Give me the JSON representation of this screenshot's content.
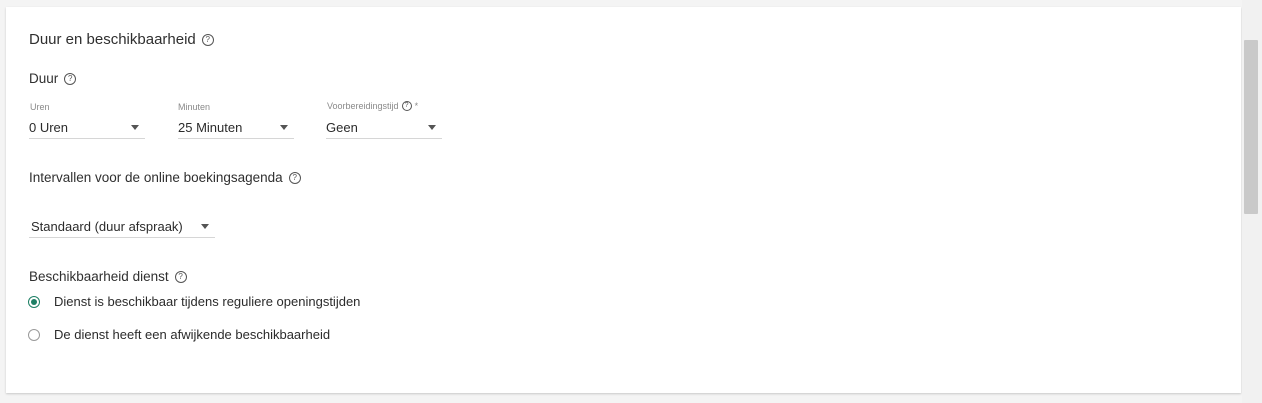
{
  "section": {
    "title": "Duur en beschikbaarheid",
    "duration": {
      "title": "Duur",
      "hours": {
        "label": "Uren",
        "value": "0 Uren"
      },
      "minutes": {
        "label": "Minuten",
        "value": "25 Minuten"
      },
      "prep": {
        "label": "Voorbereidingstijd",
        "required_mark": "*",
        "value": "Geen"
      }
    },
    "intervals": {
      "title": "Intervallen voor de online boekingsagenda",
      "value": "Standaard (duur afspraak)"
    },
    "availability": {
      "title": "Beschikbaarheid dienst",
      "options": [
        {
          "label": "Dienst is beschikbaar tijdens reguliere openingstijden",
          "checked": true
        },
        {
          "label": "De dienst heeft een afwijkende beschikbaarheid",
          "checked": false
        }
      ]
    }
  },
  "colors": {
    "accent": "#1d7f64"
  },
  "icons": {
    "help": "help-circle-icon",
    "dropdown": "caret-down-icon"
  }
}
